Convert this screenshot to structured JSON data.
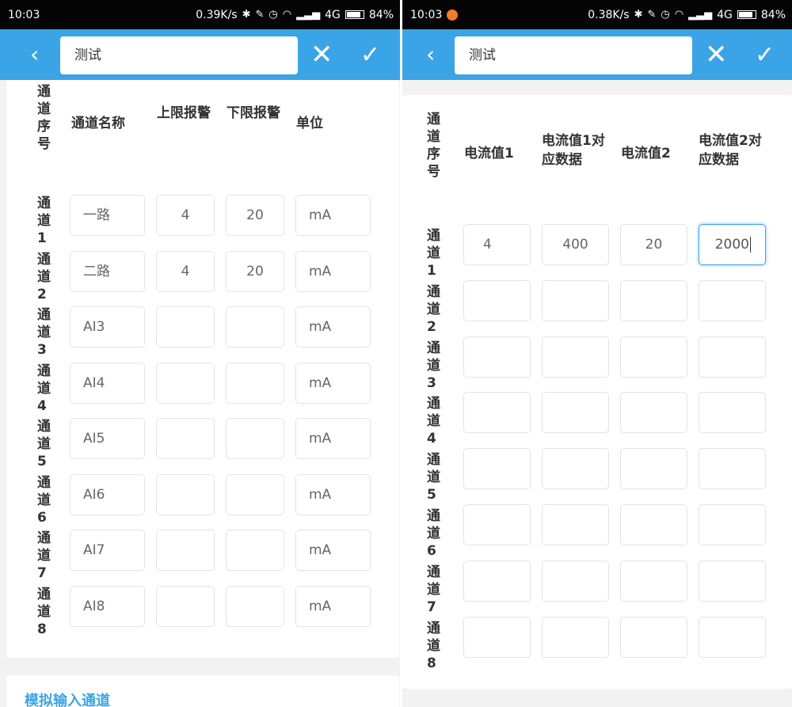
{
  "left": {
    "status": {
      "time": "10:03",
      "speed": "0.39K/s",
      "signal": "4G",
      "battery": "84%",
      "battery_level": 0.84
    },
    "appbar": {
      "back_icon": "‹",
      "search_value": "测试",
      "close_icon": "✕",
      "confirm_icon": "✓"
    },
    "headers": {
      "index": "通道序号",
      "name": "通道名称",
      "upper": "上限报警",
      "lower": "下限报警",
      "unit": "单位"
    },
    "rows": [
      {
        "label": "通道1",
        "name": "一路",
        "upper": "4",
        "lower": "20",
        "unit": "mA"
      },
      {
        "label": "通道2",
        "name": "二路",
        "upper": "4",
        "lower": "20",
        "unit": "mA"
      },
      {
        "label": "通道3",
        "name": "AI3",
        "upper": "",
        "lower": "",
        "unit": "mA"
      },
      {
        "label": "通道4",
        "name": "AI4",
        "upper": "",
        "lower": "",
        "unit": "mA"
      },
      {
        "label": "通道5",
        "name": "AI5",
        "upper": "",
        "lower": "",
        "unit": "mA"
      },
      {
        "label": "通道6",
        "name": "AI6",
        "upper": "",
        "lower": "",
        "unit": "mA"
      },
      {
        "label": "通道7",
        "name": "AI7",
        "upper": "",
        "lower": "",
        "unit": "mA"
      },
      {
        "label": "通道8",
        "name": "AI8",
        "upper": "",
        "lower": "",
        "unit": "mA"
      }
    ],
    "section_title": "模拟输入通道"
  },
  "right": {
    "status": {
      "time": "10:03",
      "speed": "0.38K/s",
      "signal": "4G",
      "battery": "84%",
      "battery_level": 0.84
    },
    "appbar": {
      "back_icon": "‹",
      "search_value": "测试",
      "close_icon": "✕",
      "confirm_icon": "✓"
    },
    "headers": {
      "index": "通道序号",
      "current1": "电流值1",
      "data1": "电流值1对应数据",
      "current2": "电流值2",
      "data2": "电流值2对应数据"
    },
    "rows": [
      {
        "label": "通道1",
        "current1": "4",
        "data1": "400",
        "current2": "20",
        "data2": "2000"
      },
      {
        "label": "通道2",
        "current1": "",
        "data1": "",
        "current2": "",
        "data2": ""
      },
      {
        "label": "通道3",
        "current1": "",
        "data1": "",
        "current2": "",
        "data2": ""
      },
      {
        "label": "通道4",
        "current1": "",
        "data1": "",
        "current2": "",
        "data2": ""
      },
      {
        "label": "通道5",
        "current1": "",
        "data1": "",
        "current2": "",
        "data2": ""
      },
      {
        "label": "通道6",
        "current1": "",
        "data1": "",
        "current2": "",
        "data2": ""
      },
      {
        "label": "通道7",
        "current1": "",
        "data1": "",
        "current2": "",
        "data2": ""
      },
      {
        "label": "通道8",
        "current1": "",
        "data1": "",
        "current2": "",
        "data2": ""
      }
    ]
  },
  "colors": {
    "accent": "#3aa4e6",
    "statusbar": "#050505",
    "background": "#f2f2f2",
    "recording_dot": "#f07d2c"
  }
}
